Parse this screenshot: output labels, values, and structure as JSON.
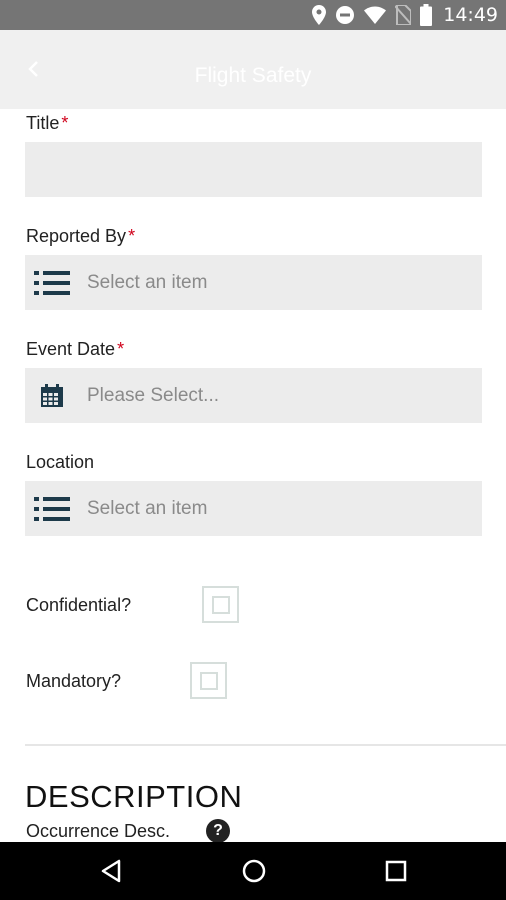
{
  "status_bar": {
    "time": "14:49",
    "icons": [
      "location-icon",
      "do-not-disturb-icon",
      "wifi-icon",
      "no-sim-icon",
      "battery-icon"
    ]
  },
  "app_bar": {
    "title": "Flight Safety",
    "back_icon": "chevron-left-icon"
  },
  "form": {
    "title_field": {
      "label": "Title",
      "required_mark": "*",
      "value": ""
    },
    "reported_by": {
      "label": "Reported By",
      "required_mark": "*",
      "placeholder": "Select an item",
      "icon": "list-icon"
    },
    "event_date": {
      "label": "Event Date",
      "required_mark": "*",
      "placeholder": "Please Select...",
      "icon": "calendar-icon"
    },
    "location": {
      "label": "Location",
      "placeholder": "Select an item",
      "icon": "list-icon"
    },
    "confidential": {
      "label": "Confidential?",
      "checked": false
    },
    "mandatory": {
      "label": "Mandatory?",
      "checked": false
    }
  },
  "description": {
    "heading": "DESCRIPTION",
    "occurrence_label": "Occurrence Desc.",
    "help_glyph": "?"
  },
  "nav_bar": {
    "buttons": [
      "back-triangle-icon",
      "home-circle-icon",
      "recents-square-icon"
    ]
  },
  "colors": {
    "status_bar": "#757575",
    "app_bar": "#f0f0f0",
    "input_bg": "#ececec",
    "required": "#d0021b",
    "icon_dark": "#1d3a4a",
    "checkbox_border": "#d6dedb"
  }
}
